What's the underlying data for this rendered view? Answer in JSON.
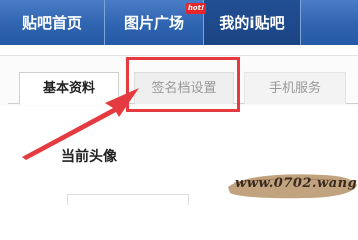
{
  "nav": {
    "items": [
      {
        "label": "贴吧首页"
      },
      {
        "label": "图片广场"
      },
      {
        "label": "我的i贴吧"
      }
    ],
    "hot_badge": "hot!"
  },
  "tabs": [
    {
      "label": "基本资料",
      "active": true
    },
    {
      "label": "签名档设置",
      "active": false
    },
    {
      "label": "手机服务",
      "active": false
    }
  ],
  "section": {
    "title": "当前头像"
  },
  "annotation": {
    "highlight_color": "#e53a3f",
    "arrow_color": "#e53a3f"
  },
  "watermark": {
    "text": "www.0702.wang"
  },
  "colors": {
    "nav_bg": "#2f64b1",
    "nav_active": "#1b4484"
  }
}
